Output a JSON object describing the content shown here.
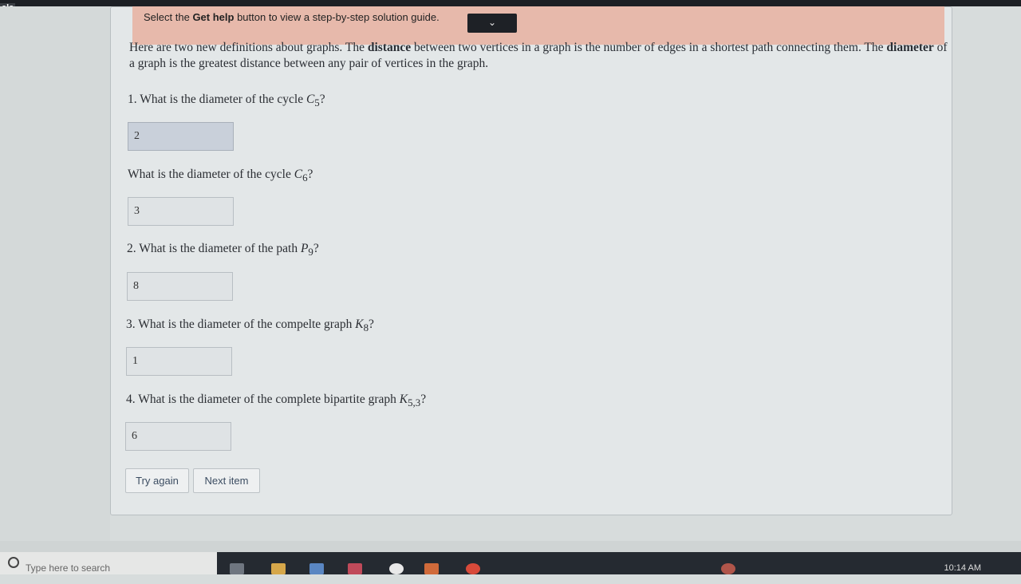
{
  "window": {
    "corner_tag": "als"
  },
  "help_banner": {
    "prefix": "Select the ",
    "bold": "Get help",
    "suffix": " button to view a step-by-step solution guide.",
    "toggle_icon": "chevron-down-icon",
    "toggle_glyph": "⌄"
  },
  "intro": {
    "p1": "Here are two new definitions about graphs. The ",
    "b1": "distance",
    "p2": " between two vertices in a graph is the number of edges in a shortest path connecting them. The ",
    "b2": "diameter",
    "p3": " of a graph is the greatest distance between any pair of vertices in the graph."
  },
  "questions": [
    {
      "prefix": "1. What is the diameter of the cycle ",
      "graph": "C",
      "sub": "5",
      "suffix": "?",
      "answer": "2"
    },
    {
      "prefix": "What is the diameter of the cycle ",
      "graph": "C",
      "sub": "6",
      "suffix": "?",
      "answer": "3"
    },
    {
      "prefix": "2. What is the diameter of the path ",
      "graph": "P",
      "sub": "9",
      "suffix": "?",
      "answer": "8"
    },
    {
      "prefix": "3. What is the diameter of the compelte graph ",
      "graph": "K",
      "sub": "8",
      "suffix": "?",
      "answer": "1"
    },
    {
      "prefix": "4. What is the diameter of the complete bipartite graph ",
      "graph": "K",
      "sub": "5,3",
      "suffix": "?",
      "answer": "6"
    }
  ],
  "buttons": {
    "try_again": "Try again",
    "next_item": "Next item"
  },
  "taskbar": {
    "search_placeholder": "Type here to search",
    "clock": "10:14 AM"
  },
  "colors": {
    "banner": "#e7b9ab",
    "panel": "#e3e7e8",
    "taskbar": "#252a31"
  }
}
